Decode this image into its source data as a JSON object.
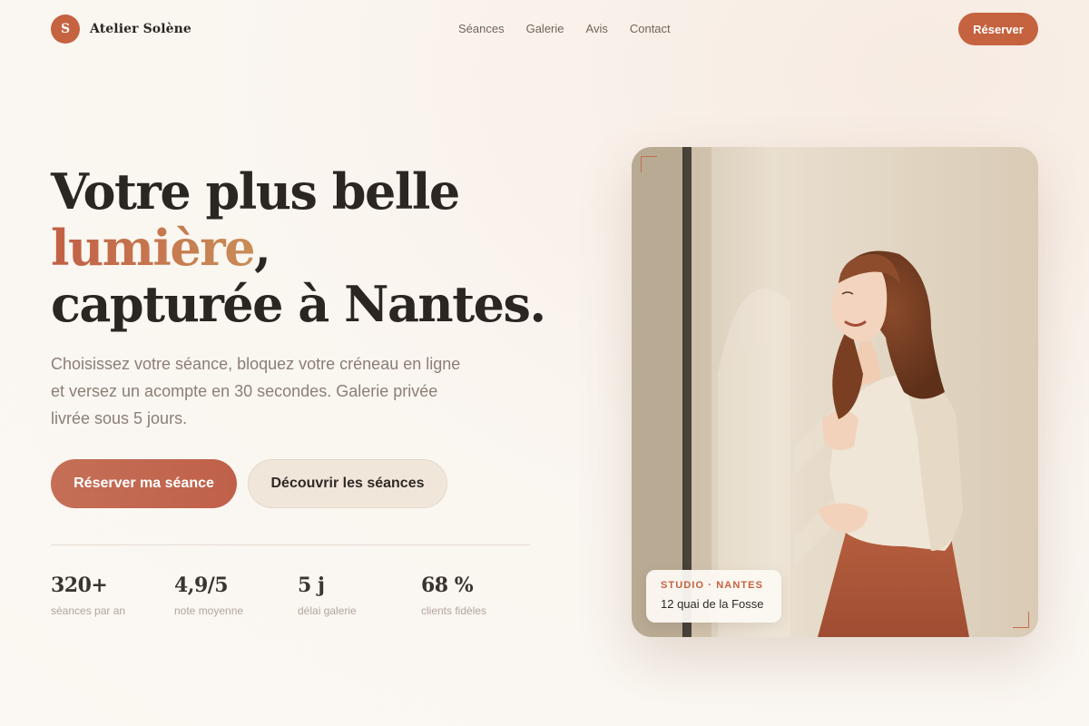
{
  "header": {
    "logo_letter": "S",
    "brand": "Atelier Solène",
    "nav": [
      "Séances",
      "Galerie",
      "Avis",
      "Contact"
    ],
    "cta": "Réserver"
  },
  "hero": {
    "headline_line1": "Votre plus belle",
    "headline_accent": "lumière",
    "headline_comma": ",",
    "headline_line3": "capturée à Nantes.",
    "subtitle": "Choisissez votre séance, bloquez votre créneau en ligne et versez un acompte en 30 secondes. Galerie privée livrée sous 5 jours.",
    "primary_button": "Réserver ma séance",
    "secondary_button": "Découvrir les séances"
  },
  "stats": [
    {
      "value": "320+",
      "label": "séances par an"
    },
    {
      "value": "4,9/5",
      "label": "note moyenne"
    },
    {
      "value": "5 j",
      "label": "délai galerie"
    },
    {
      "value": "68 %",
      "label": "clients fidèles"
    }
  ],
  "photo": {
    "location_title": "STUDIO · NANTES",
    "location_address": "12 quai de la Fosse"
  },
  "colors": {
    "accent": "#c5623f",
    "accent_gold": "#c98d57",
    "background": "#fbf8f3"
  }
}
